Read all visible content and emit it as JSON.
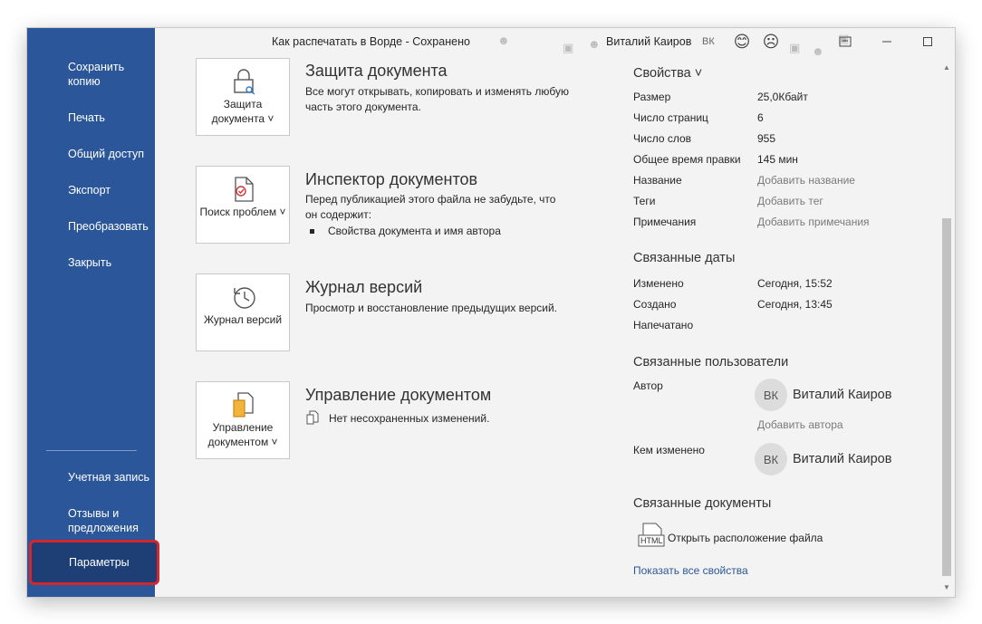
{
  "window": {
    "doc_title": "Как распечатать в Ворде - Сохранено",
    "user_name": "Виталий Каиров",
    "user_initials": "ВК",
    "smile_icon": "😊",
    "frown_icon": "☹"
  },
  "sidebar": {
    "items": [
      {
        "label": "Сохранить копию"
      },
      {
        "label": "Печать"
      },
      {
        "label": "Общий доступ"
      },
      {
        "label": "Экспорт"
      },
      {
        "label": "Преобразовать"
      },
      {
        "label": "Закрыть"
      }
    ],
    "bottom": [
      {
        "label": "Учетная запись"
      },
      {
        "label": "Отзывы и предложения"
      },
      {
        "label": "Параметры"
      }
    ]
  },
  "sections": [
    {
      "button": "Защита документа ˅",
      "title": "Защита документа",
      "desc": "Все могут открывать, копировать и изменять любую часть этого документа."
    },
    {
      "button": "Поиск проблем ˅",
      "title": "Инспектор документов",
      "desc": "Перед публикацией этого файла не забудьте, что он содержит:",
      "bullet": "Свойства документа и имя автора"
    },
    {
      "button": "Журнал версий",
      "title": "Журнал версий",
      "desc": "Просмотр и восстановление предыдущих версий."
    },
    {
      "button": "Управление документом ˅",
      "title": "Управление документом",
      "desc": "Нет несохраненных изменений."
    }
  ],
  "properties": {
    "heading": "Свойства ˅",
    "rows": [
      {
        "key": "Размер",
        "value": "25,0Кбайт"
      },
      {
        "key": "Число страниц",
        "value": "6"
      },
      {
        "key": "Число слов",
        "value": "955"
      },
      {
        "key": "Общее время правки",
        "value": "145 мин"
      },
      {
        "key": "Название",
        "value": "Добавить название"
      },
      {
        "key": "Теги",
        "value": "Добавить тег"
      },
      {
        "key": "Примечания",
        "value": "Добавить примечания"
      }
    ]
  },
  "dates": {
    "heading": "Связанные даты",
    "rows": [
      {
        "key": "Изменено",
        "value": "Сегодня, 15:52"
      },
      {
        "key": "Создано",
        "value": "Сегодня, 13:45"
      },
      {
        "key": "Напечатано",
        "value": ""
      }
    ]
  },
  "people": {
    "heading": "Связанные пользователи",
    "author_key": "Автор",
    "author_initials": "ВК",
    "author_name": "Виталий Каиров",
    "add_author": "Добавить автора",
    "modified_key": "Кем изменено",
    "modified_initials": "ВК",
    "modified_name": "Виталий Каиров"
  },
  "docs": {
    "heading": "Связанные документы",
    "open_location": "Открыть расположение файла",
    "file_badge": "HTML",
    "show_all": "Показать все свойства"
  }
}
